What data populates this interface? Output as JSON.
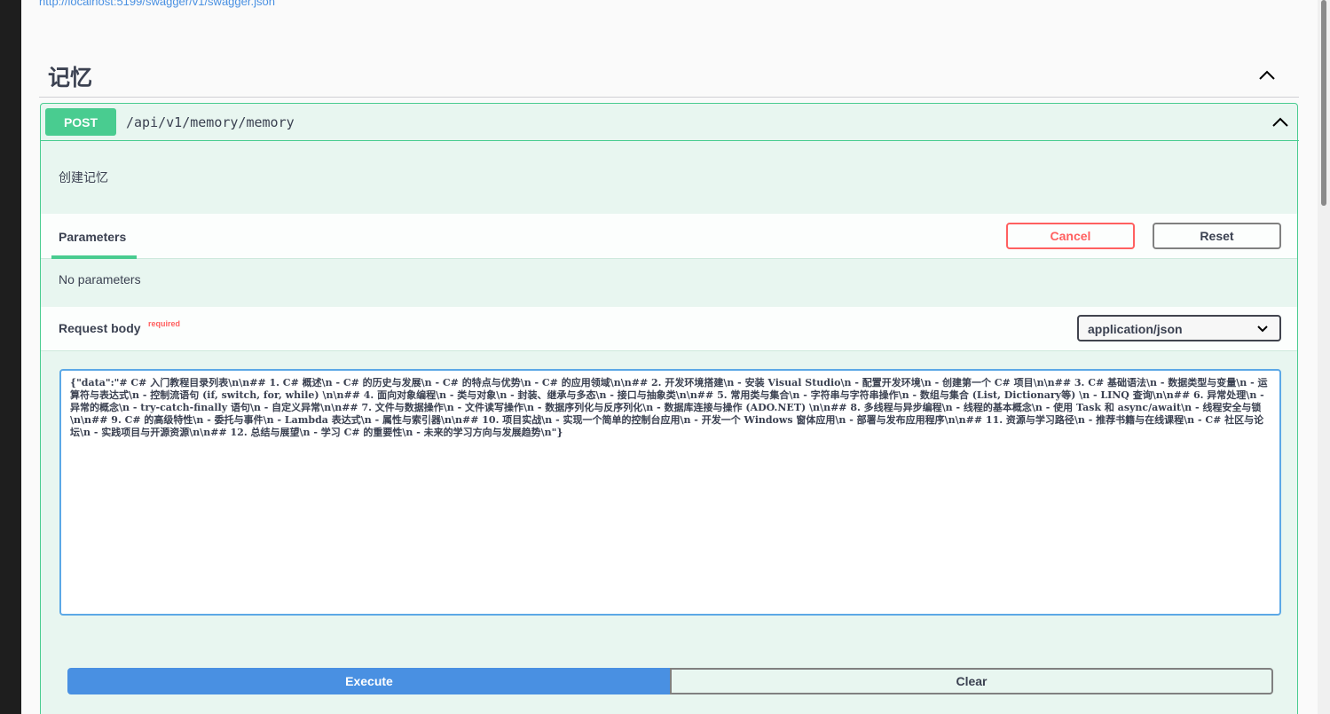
{
  "top": {
    "url": "http://localhost:5199/swagger/v1/swagger.json"
  },
  "section": {
    "title": "记忆",
    "toggle_icon": "chevron-up-icon"
  },
  "operation": {
    "method": "POST",
    "path": "/api/v1/memory/memory",
    "description": "创建记忆",
    "method_color": "#49cc90",
    "collapse_icon": "chevron-up-icon"
  },
  "parameters": {
    "tab_label": "Parameters",
    "cancel_label": "Cancel",
    "reset_label": "Reset",
    "empty_text": "No parameters"
  },
  "request_body": {
    "label": "Request body",
    "required_label": "required",
    "content_type": "application/json",
    "value": "{\"data\":\"# C# 入门教程目录列表\\n\\n## 1. C# 概述\\n   - C# 的历史与发展\\n   - C# 的特点与优势\\n   - C# 的应用领域\\n\\n## 2. 开发环境搭建\\n   - 安装 Visual Studio\\n   - 配置开发环境\\n   - 创建第一个 C# 项目\\n\\n## 3. C# 基础语法\\n   - 数据类型与变量\\n   - 运算符与表达式\\n   - 控制流语句 (if, switch, for, while) \\n\\n## 4. 面向对象编程\\n   - 类与对象\\n   - 封装、继承与多态\\n   - 接口与抽象类\\n\\n## 5. 常用类与集合\\n   - 字符串与字符串操作\\n   - 数组与集合 (List, Dictionary等) \\n   - LINQ 查询\\n\\n## 6. 异常处理\\n   - 异常的概念\\n   - try-catch-finally 语句\\n   - 自定义异常\\n\\n## 7. 文件与数据操作\\n   - 文件读写操作\\n   - 数据序列化与反序列化\\n   - 数据库连接与操作 (ADO.NET) \\n\\n## 8. 多线程与异步编程\\n   - 线程的基本概念\\n   - 使用 Task 和 async/await\\n   - 线程安全与锁\\n\\n## 9. C# 的高级特性\\n   - 委托与事件\\n   - Lambda 表达式\\n   - 属性与索引器\\n\\n## 10. 项目实战\\n   - 实现一个简单的控制台应用\\n   - 开发一个 Windows 窗体应用\\n   - 部署与发布应用程序\\n\\n## 11. 资源与学习路径\\n   - 推荐书籍与在线课程\\n   - C# 社区与论坛\\n   - 实践项目与开源资源\\n\\n## 12. 总结与展望\\n   - 学习 C# 的重要性\\n   - 未来的学习方向与发展趋势\\n\"}"
  },
  "actions": {
    "execute_label": "Execute",
    "clear_label": "Clear",
    "execute_color": "#4990e2"
  }
}
